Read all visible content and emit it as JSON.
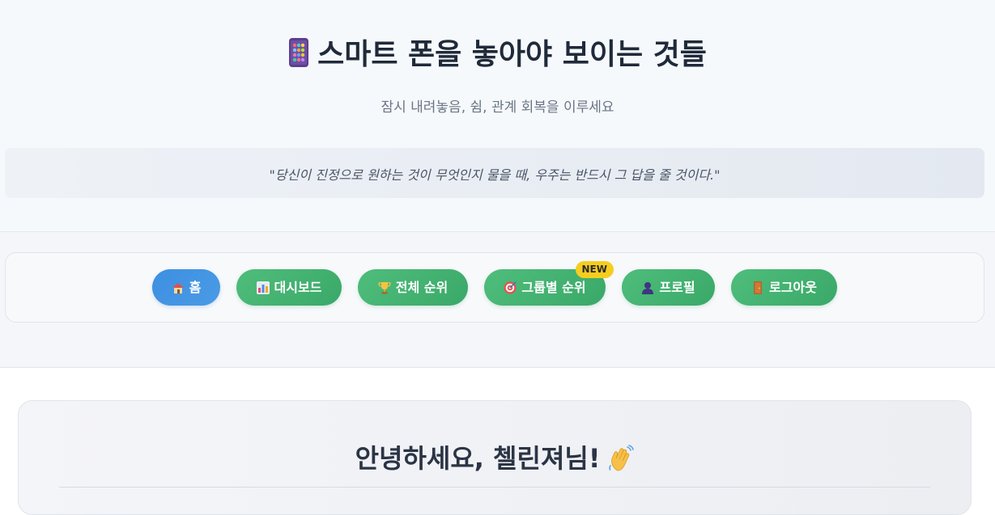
{
  "header": {
    "title": "스마트 폰을 놓아야 보이는 것들",
    "title_icon": "phone-icon",
    "subtitle": "잠시 내려놓음, 쉼, 관계 회복을 이루세요",
    "quote": "\"당신이 진정으로 원하는 것이 무엇인지 물을 때, 우주는 반드시 그 답을 줄 것이다.\""
  },
  "nav": {
    "items": [
      {
        "label": "홈",
        "icon": "house-icon",
        "active": true
      },
      {
        "label": "대시보드",
        "icon": "bar-chart-icon",
        "active": false
      },
      {
        "label": "전체 순위",
        "icon": "trophy-icon",
        "active": false
      },
      {
        "label": "그룹별 순위",
        "icon": "target-icon",
        "active": false,
        "badge": "NEW"
      },
      {
        "label": "프로필",
        "icon": "user-icon",
        "active": false
      },
      {
        "label": "로그아웃",
        "icon": "door-icon",
        "active": false
      }
    ]
  },
  "main": {
    "greeting": "안녕하세요, 첼린져님!",
    "greeting_icon": "waving-hand-icon"
  },
  "colors": {
    "nav_green": "#45b473",
    "nav_active_blue": "#3d8fe0",
    "badge_yellow": "#f6cd1f",
    "title_text": "#1f2a3a"
  }
}
